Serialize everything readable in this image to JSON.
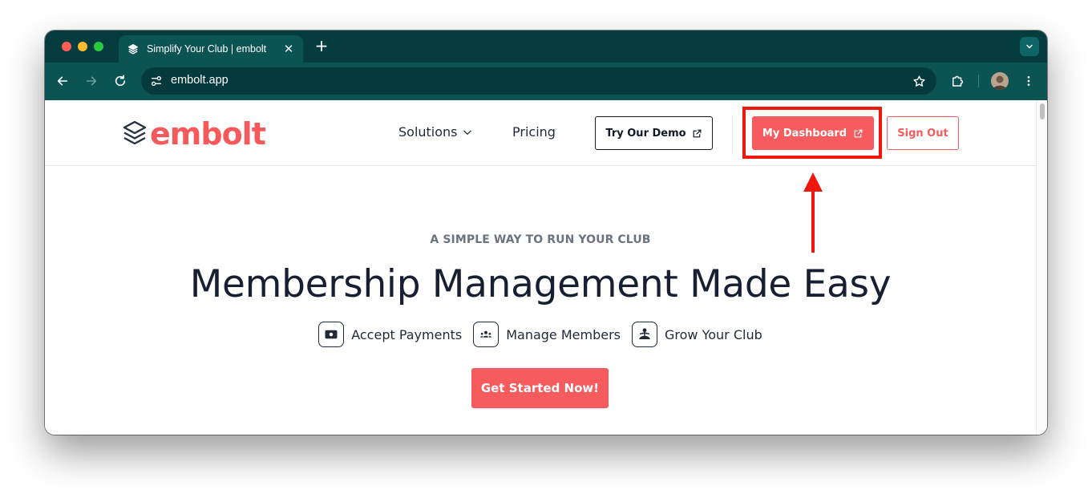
{
  "browser": {
    "tab": {
      "title": "Simplify Your Club | embolt",
      "close_glyph": "✕"
    },
    "new_tab_glyph": "+",
    "address_bar": {
      "url": "embolt.app"
    }
  },
  "site": {
    "logo_text": "embolt",
    "brand_color": "#f65b5d",
    "nav": {
      "solutions": "Solutions",
      "pricing": "Pricing"
    },
    "buttons": {
      "demo": "Try Our Demo",
      "dashboard": "My Dashboard",
      "sign_out": "Sign Out"
    },
    "hero": {
      "eyebrow": "A SIMPLE WAY TO RUN YOUR CLUB",
      "headline": "Membership Management Made Easy",
      "features": [
        {
          "label": "Accept Payments",
          "icon": "payments-icon"
        },
        {
          "label": "Manage Members",
          "icon": "members-icon"
        },
        {
          "label": "Grow Your Club",
          "icon": "grow-icon"
        }
      ],
      "cta": "Get Started Now!"
    }
  },
  "annotation": {
    "highlight_color": "#f0170e"
  }
}
